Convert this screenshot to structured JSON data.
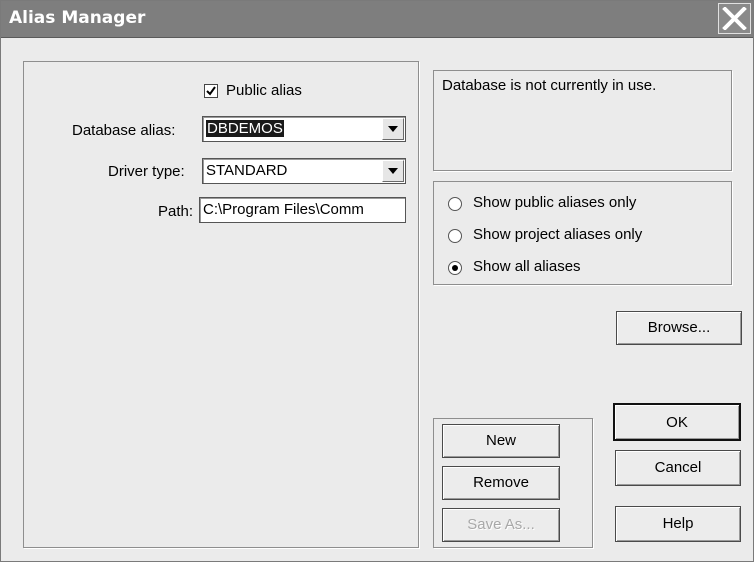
{
  "window": {
    "title": "Alias Manager"
  },
  "left": {
    "public_alias_label": "Public alias",
    "public_alias_checked": true,
    "database_alias_label": "Database alias:",
    "database_alias_value": "DBDEMOS",
    "driver_type_label": "Driver type:",
    "driver_type_value": "STANDARD",
    "path_label": "Path:",
    "path_value": "C:\\Program Files\\Comm"
  },
  "status": {
    "text": "Database is not currently in use."
  },
  "filter": {
    "options": [
      {
        "label": "Show public aliases only",
        "selected": false
      },
      {
        "label": "Show project aliases only",
        "selected": false
      },
      {
        "label": "Show all aliases",
        "selected": true
      }
    ]
  },
  "buttons": {
    "browse": "Browse...",
    "new": "New",
    "remove": "Remove",
    "save_as": "Save As...",
    "ok": "OK",
    "cancel": "Cancel",
    "help": "Help"
  },
  "icons": {
    "close": "close-icon",
    "check": "check-icon",
    "dropdown": "chevron-down-icon"
  }
}
